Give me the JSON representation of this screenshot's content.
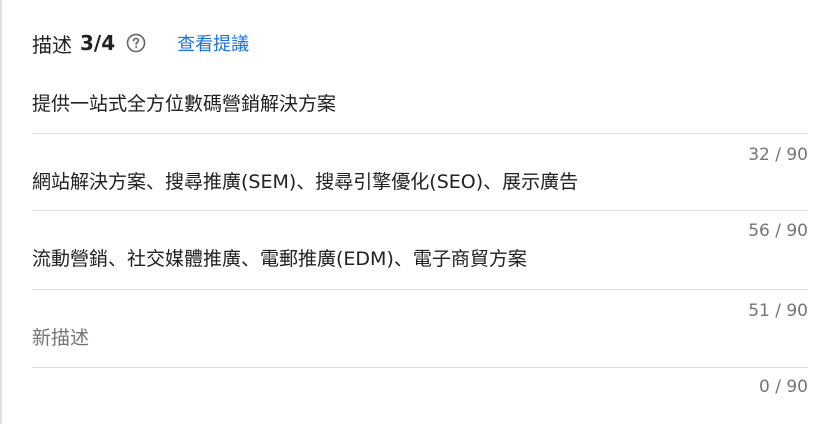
{
  "header": {
    "label": "描述",
    "count": "3/4",
    "help_icon": "help-circle-icon",
    "suggest_link": "查看提議"
  },
  "fields": [
    {
      "value": "提供一站式全方位數碼營銷解決方案",
      "placeholder": "",
      "counter": "32 / 90"
    },
    {
      "value": "網站解決方案、搜尋推廣(SEM)、搜尋引擎優化(SEO)、展示廣告",
      "placeholder": "",
      "counter": "56 / 90"
    },
    {
      "value": "流動營銷、社交媒體推廣、電郵推廣(EDM)、電子商貿方案",
      "placeholder": "",
      "counter": "51 / 90"
    },
    {
      "value": "",
      "placeholder": "新描述",
      "counter": "0 / 90"
    }
  ],
  "colors": {
    "link": "#1a73e8",
    "text": "#202124",
    "secondary": "#757575",
    "divider": "#dadce0"
  }
}
